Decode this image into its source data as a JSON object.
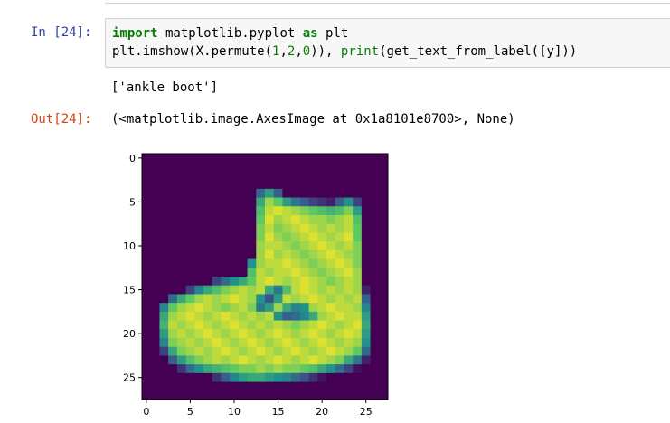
{
  "cells": {
    "input": {
      "prompt": "In [24]:",
      "line1": [
        {
          "t": "import",
          "c": "kw"
        },
        {
          "t": " matplotlib.pyplot ",
          "c": ""
        },
        {
          "t": "as",
          "c": "kw"
        },
        {
          "t": " plt",
          "c": ""
        }
      ],
      "line2": [
        {
          "t": "plt.imshow(X.permute(",
          "c": ""
        },
        {
          "t": "1",
          "c": "num"
        },
        {
          "t": ",",
          "c": ""
        },
        {
          "t": "2",
          "c": "num"
        },
        {
          "t": ",",
          "c": ""
        },
        {
          "t": "0",
          "c": "num"
        },
        {
          "t": ")), ",
          "c": ""
        },
        {
          "t": "print",
          "c": "builtin"
        },
        {
          "t": "(get_text_from_label([y]))",
          "c": ""
        }
      ]
    },
    "stdout": "['ankle boot']",
    "output": {
      "prompt": "Out[24]:",
      "text": "(<matplotlib.image.AxesImage at 0x1a8101e8700>, None)"
    }
  },
  "chart_data": {
    "type": "heatmap",
    "title": "",
    "xlabel": "",
    "ylabel": "",
    "x_ticks": [
      0,
      5,
      10,
      15,
      20,
      25
    ],
    "y_ticks": [
      0,
      5,
      10,
      15,
      20,
      25
    ],
    "xlim": [
      -0.5,
      27.5
    ],
    "ylim": [
      27.5,
      -0.5
    ],
    "colormap": "viridis",
    "colors": {
      "background": "#440154",
      "mid": "#21908d",
      "high": "#fde725"
    },
    "grid": false,
    "shape": [
      28,
      28
    ],
    "values": [
      [
        0,
        0,
        0,
        0,
        0,
        0,
        0,
        0,
        0,
        0,
        0,
        0,
        0,
        0,
        0,
        0,
        0,
        0,
        0,
        0,
        0,
        0,
        0,
        0,
        0,
        0,
        0,
        0
      ],
      [
        0,
        0,
        0,
        0,
        0,
        0,
        0,
        0,
        0,
        0,
        0,
        0,
        0,
        0,
        0,
        0,
        0,
        0,
        0,
        0,
        0,
        0,
        0,
        0,
        0,
        0,
        0,
        0
      ],
      [
        0,
        0,
        0,
        0,
        0,
        0,
        0,
        0,
        0,
        0,
        0,
        0,
        0,
        0,
        0,
        0,
        0,
        0,
        0,
        0,
        0,
        0,
        0,
        0,
        0,
        0,
        0,
        0
      ],
      [
        0,
        0,
        0,
        0,
        0,
        0,
        0,
        0,
        0,
        0,
        0,
        0,
        0,
        0,
        0,
        0,
        0,
        0,
        0,
        0,
        0,
        0,
        0,
        0,
        0,
        0,
        0,
        0
      ],
      [
        0,
        0,
        0,
        0,
        0,
        0,
        0,
        0,
        0,
        0,
        0,
        0,
        0,
        0.35,
        0.55,
        0.3,
        0,
        0,
        0,
        0,
        0,
        0,
        0,
        0,
        0,
        0,
        0,
        0
      ],
      [
        0,
        0,
        0,
        0,
        0,
        0,
        0,
        0,
        0,
        0,
        0,
        0,
        0,
        0.6,
        0.85,
        0.75,
        0.55,
        0.4,
        0.3,
        0.2,
        0.15,
        0.1,
        0.3,
        0.5,
        0.2,
        0,
        0,
        0
      ],
      [
        0,
        0,
        0,
        0,
        0,
        0,
        0,
        0,
        0,
        0,
        0,
        0,
        0,
        0.7,
        0.9,
        0.95,
        0.9,
        0.85,
        0.8,
        0.75,
        0.7,
        0.65,
        0.7,
        0.8,
        0.55,
        0,
        0,
        0
      ],
      [
        0,
        0,
        0,
        0,
        0,
        0,
        0,
        0,
        0,
        0,
        0,
        0,
        0,
        0.75,
        0.95,
        0.85,
        0.9,
        0.95,
        0.9,
        0.85,
        0.85,
        0.8,
        0.85,
        0.9,
        0.7,
        0,
        0,
        0
      ],
      [
        0,
        0,
        0,
        0,
        0,
        0,
        0,
        0,
        0,
        0,
        0,
        0,
        0,
        0.8,
        0.9,
        0.8,
        0.85,
        0.9,
        0.95,
        0.9,
        0.85,
        0.9,
        0.85,
        0.9,
        0.75,
        0,
        0,
        0
      ],
      [
        0,
        0,
        0,
        0,
        0,
        0,
        0,
        0,
        0,
        0,
        0,
        0,
        0,
        0.8,
        0.95,
        0.85,
        0.8,
        0.85,
        0.9,
        0.95,
        0.9,
        0.85,
        0.9,
        0.95,
        0.75,
        0,
        0,
        0
      ],
      [
        0,
        0,
        0,
        0,
        0,
        0,
        0,
        0,
        0,
        0,
        0,
        0,
        0,
        0.85,
        0.9,
        0.9,
        0.85,
        0.8,
        0.85,
        0.9,
        0.95,
        0.9,
        0.85,
        0.9,
        0.8,
        0,
        0,
        0
      ],
      [
        0,
        0,
        0,
        0,
        0,
        0,
        0,
        0,
        0,
        0,
        0,
        0,
        0,
        0.85,
        0.95,
        0.85,
        0.9,
        0.85,
        0.8,
        0.85,
        0.9,
        0.95,
        0.9,
        0.85,
        0.8,
        0,
        0,
        0
      ],
      [
        0,
        0,
        0,
        0,
        0,
        0,
        0,
        0,
        0,
        0,
        0,
        0,
        0.5,
        0.85,
        0.9,
        0.9,
        0.95,
        0.9,
        0.85,
        0.8,
        0.85,
        0.9,
        0.95,
        0.9,
        0.8,
        0,
        0,
        0
      ],
      [
        0,
        0,
        0,
        0,
        0,
        0,
        0,
        0,
        0,
        0,
        0,
        0,
        0.7,
        0.9,
        0.85,
        0.9,
        0.9,
        0.95,
        0.9,
        0.85,
        0.8,
        0.85,
        0.9,
        0.95,
        0.85,
        0,
        0,
        0
      ],
      [
        0,
        0,
        0,
        0,
        0,
        0,
        0,
        0,
        0.2,
        0.35,
        0.5,
        0.6,
        0.75,
        0.9,
        0.95,
        0.9,
        0.85,
        0.9,
        0.95,
        0.9,
        0.85,
        0.8,
        0.85,
        0.9,
        0.85,
        0,
        0,
        0
      ],
      [
        0,
        0,
        0,
        0,
        0,
        0.2,
        0.45,
        0.6,
        0.7,
        0.8,
        0.85,
        0.9,
        0.85,
        0.9,
        0.6,
        0.4,
        0.7,
        0.9,
        0.95,
        0.9,
        0.85,
        0.9,
        0.85,
        0.9,
        0.85,
        0.1,
        0,
        0
      ],
      [
        0,
        0,
        0,
        0.35,
        0.6,
        0.75,
        0.85,
        0.9,
        0.85,
        0.9,
        0.95,
        0.9,
        0.85,
        0.5,
        0.25,
        0.55,
        0.9,
        0.85,
        0.9,
        0.95,
        0.9,
        0.85,
        0.9,
        0.85,
        0.9,
        0.3,
        0,
        0
      ],
      [
        0,
        0,
        0.45,
        0.75,
        0.85,
        0.9,
        0.95,
        0.9,
        0.85,
        0.8,
        0.85,
        0.9,
        0.8,
        0.4,
        0.55,
        0.85,
        0.6,
        0.45,
        0.5,
        0.85,
        0.9,
        0.95,
        0.9,
        0.9,
        0.85,
        0.45,
        0,
        0
      ],
      [
        0,
        0,
        0.6,
        0.85,
        0.9,
        0.95,
        0.9,
        0.85,
        0.9,
        0.95,
        0.9,
        0.85,
        0.9,
        0.85,
        0.9,
        0.5,
        0.3,
        0.35,
        0.45,
        0.6,
        0.85,
        0.9,
        0.95,
        0.9,
        0.9,
        0.55,
        0,
        0
      ],
      [
        0,
        0,
        0.65,
        0.9,
        0.85,
        0.9,
        0.95,
        0.9,
        0.85,
        0.9,
        0.95,
        0.9,
        0.85,
        0.9,
        0.85,
        0.9,
        0.85,
        0.8,
        0.85,
        0.9,
        0.95,
        0.9,
        0.85,
        0.9,
        0.95,
        0.6,
        0,
        0
      ],
      [
        0,
        0,
        0.55,
        0.85,
        0.9,
        0.85,
        0.9,
        0.95,
        0.9,
        0.85,
        0.9,
        0.95,
        0.9,
        0.85,
        0.9,
        0.95,
        0.9,
        0.85,
        0.9,
        0.95,
        0.9,
        0.85,
        0.9,
        0.95,
        0.9,
        0.55,
        0,
        0
      ],
      [
        0,
        0,
        0.45,
        0.8,
        0.85,
        0.9,
        0.85,
        0.9,
        0.95,
        0.9,
        0.85,
        0.9,
        0.95,
        0.9,
        0.85,
        0.9,
        0.95,
        0.9,
        0.85,
        0.9,
        0.95,
        0.9,
        0.85,
        0.9,
        0.85,
        0.5,
        0,
        0
      ],
      [
        0,
        0,
        0.2,
        0.6,
        0.8,
        0.85,
        0.9,
        0.85,
        0.9,
        0.95,
        0.9,
        0.85,
        0.9,
        0.95,
        0.9,
        0.85,
        0.9,
        0.95,
        0.9,
        0.85,
        0.9,
        0.95,
        0.9,
        0.85,
        0.75,
        0.35,
        0,
        0
      ],
      [
        0,
        0,
        0,
        0.3,
        0.55,
        0.7,
        0.8,
        0.85,
        0.9,
        0.85,
        0.9,
        0.95,
        0.9,
        0.85,
        0.9,
        0.95,
        0.9,
        0.85,
        0.9,
        0.95,
        0.9,
        0.85,
        0.8,
        0.6,
        0.4,
        0.1,
        0,
        0
      ],
      [
        0,
        0,
        0,
        0,
        0.15,
        0.35,
        0.5,
        0.6,
        0.65,
        0.7,
        0.75,
        0.8,
        0.8,
        0.85,
        0.8,
        0.85,
        0.8,
        0.8,
        0.75,
        0.7,
        0.6,
        0.5,
        0.35,
        0.2,
        0.05,
        0,
        0,
        0
      ],
      [
        0,
        0,
        0,
        0,
        0,
        0,
        0,
        0,
        0.15,
        0.3,
        0.45,
        0.55,
        0.6,
        0.6,
        0.55,
        0.5,
        0.45,
        0.35,
        0.25,
        0.15,
        0.05,
        0,
        0,
        0,
        0,
        0,
        0,
        0
      ],
      [
        0,
        0,
        0,
        0,
        0,
        0,
        0,
        0,
        0,
        0,
        0,
        0,
        0,
        0,
        0,
        0,
        0,
        0,
        0,
        0,
        0,
        0,
        0,
        0,
        0,
        0,
        0,
        0
      ],
      [
        0,
        0,
        0,
        0,
        0,
        0,
        0,
        0,
        0,
        0,
        0,
        0,
        0,
        0,
        0,
        0,
        0,
        0,
        0,
        0,
        0,
        0,
        0,
        0,
        0,
        0,
        0,
        0
      ]
    ]
  }
}
